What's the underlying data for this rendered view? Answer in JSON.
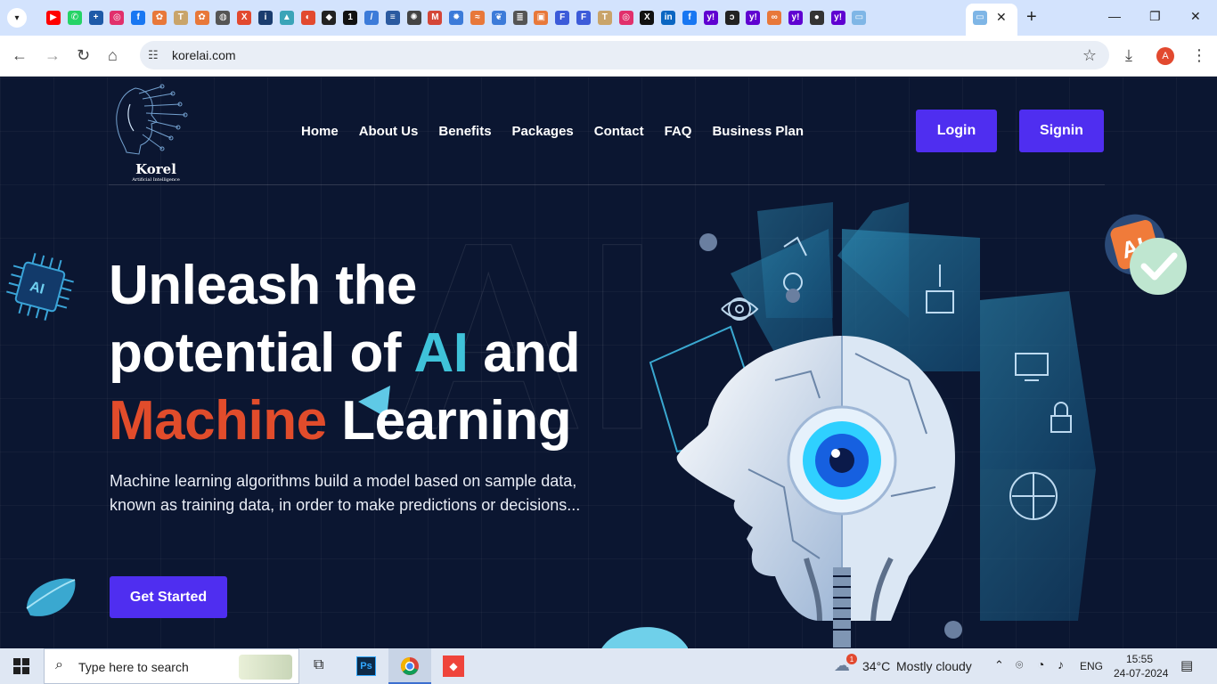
{
  "browser": {
    "url": "korelai.com",
    "profile_initial": "A",
    "favicons": [
      {
        "name": "youtube-icon",
        "glyph": "▶",
        "color": "#ff0000"
      },
      {
        "name": "whatsapp-icon",
        "glyph": "✆",
        "color": "#25d366"
      },
      {
        "name": "plus-app-icon",
        "glyph": "+",
        "color": "#1e5aa8"
      },
      {
        "name": "instagram-icon",
        "glyph": "◎",
        "color": "#e1306c"
      },
      {
        "name": "facebook-icon",
        "glyph": "f",
        "color": "#1877f2"
      },
      {
        "name": "emblem-icon",
        "glyph": "✿",
        "color": "#e8783a"
      },
      {
        "name": "t-icon",
        "glyph": "T",
        "color": "#c9a46a"
      },
      {
        "name": "emblem-icon",
        "glyph": "✿",
        "color": "#e8783a"
      },
      {
        "name": "globe-icon",
        "glyph": "◍",
        "color": "#555555"
      },
      {
        "name": "x-icon",
        "glyph": "X",
        "color": "#e2492f"
      },
      {
        "name": "indeed-icon",
        "glyph": "i",
        "color": "#1a3c6e"
      },
      {
        "name": "triangle-icon",
        "glyph": "▲",
        "color": "#3aa4b8"
      },
      {
        "name": "swirl-icon",
        "glyph": "◐",
        "color": "#e2492f"
      },
      {
        "name": "dark-app-icon",
        "glyph": "◆",
        "color": "#222222"
      },
      {
        "name": "one-icon",
        "glyph": "1",
        "color": "#111111"
      },
      {
        "name": "slash-icon",
        "glyph": "/",
        "color": "#3c7bd9"
      },
      {
        "name": "tcc-icon",
        "glyph": "≡",
        "color": "#2b5aa0"
      },
      {
        "name": "openai-icon",
        "glyph": "✺",
        "color": "#444444"
      },
      {
        "name": "gmail-icon",
        "glyph": "M",
        "color": "#d44638"
      },
      {
        "name": "gear-icon",
        "glyph": "✹",
        "color": "#3c7bd9"
      },
      {
        "name": "wave-icon",
        "glyph": "≈",
        "color": "#e8783a"
      },
      {
        "name": "leaf-icon",
        "glyph": "❦",
        "color": "#3c7bd9"
      },
      {
        "name": "stack-icon",
        "glyph": "≣",
        "color": "#555555"
      },
      {
        "name": "box-icon",
        "glyph": "▣",
        "color": "#e8783a"
      },
      {
        "name": "f-icon",
        "glyph": "F",
        "color": "#3c5bd9"
      },
      {
        "name": "f-icon",
        "glyph": "F",
        "color": "#3c5bd9"
      },
      {
        "name": "t-icon",
        "glyph": "T",
        "color": "#c9a46a"
      },
      {
        "name": "instagram-icon",
        "glyph": "◎",
        "color": "#e1306c"
      },
      {
        "name": "x-icon",
        "glyph": "X",
        "color": "#111111"
      },
      {
        "name": "linkedin-icon",
        "glyph": "in",
        "color": "#0a66c2"
      },
      {
        "name": "facebook-icon",
        "glyph": "f",
        "color": "#1877f2"
      },
      {
        "name": "yahoo-icon",
        "glyph": "y!",
        "color": "#5f01d1"
      },
      {
        "name": "hook-icon",
        "glyph": "ɔ",
        "color": "#222222"
      },
      {
        "name": "yahoo-icon",
        "glyph": "y!",
        "color": "#5f01d1"
      },
      {
        "name": "link-icon",
        "glyph": "∞",
        "color": "#e8783a"
      },
      {
        "name": "yahoo-icon",
        "glyph": "y!",
        "color": "#5f01d1"
      },
      {
        "name": "circle-icon",
        "glyph": "●",
        "color": "#333333"
      },
      {
        "name": "yahoo-icon",
        "glyph": "y!",
        "color": "#5f01d1"
      },
      {
        "name": "window-icon",
        "glyph": "▭",
        "color": "#7fb6e6"
      }
    ]
  },
  "site": {
    "logo_name": "Korel",
    "logo_sub": "Artificial Intelligence",
    "nav": [
      "Home",
      "About Us",
      "Benefits",
      "Packages",
      "Contact",
      "FAQ",
      "Business Plan"
    ],
    "login_label": "Login",
    "signin_label": "Signin",
    "bg_watermark": "AI",
    "hero_line1": "Unleash the",
    "hero_line2_a": "potential of ",
    "hero_line2_ai": "AI",
    "hero_line2_b": " and",
    "hero_line3_ml": "Machine",
    "hero_line3_b": " Learning",
    "hero_desc": "Machine learning algorithms build a model based on sample data, known as training data, in order to make predictions or decisions...",
    "cta_label": "Get Started",
    "colors": {
      "accent_purple": "#4f2ef0",
      "ai_cyan": "#3fc2d9",
      "ml_orange": "#e14c2b",
      "bg_navy": "#0b1631"
    }
  },
  "taskbar": {
    "search_placeholder": "Type here to search",
    "weather_temp": "34°C",
    "weather_desc": "Mostly cloudy",
    "weather_badge": "1",
    "lang": "ENG",
    "time": "15:55",
    "date": "24-07-2024",
    "ps_label": "Ps"
  }
}
